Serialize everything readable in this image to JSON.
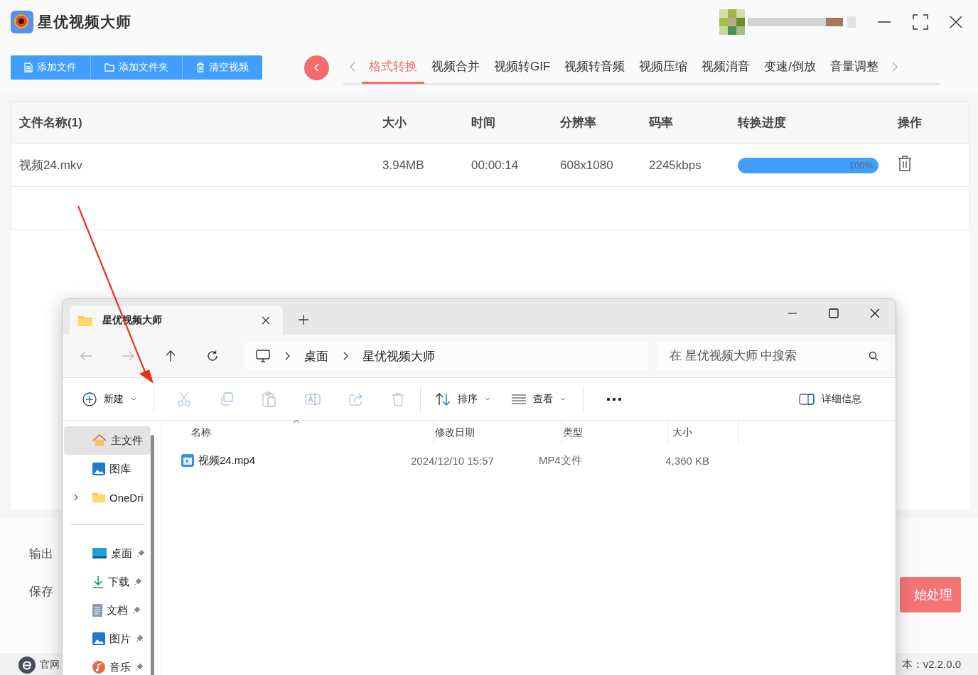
{
  "app": {
    "title": "星优视频大师"
  },
  "actions": [
    {
      "label": "添加文件",
      "kind": "file"
    },
    {
      "label": "添加文件夹",
      "kind": "folder"
    },
    {
      "label": "清空视频",
      "kind": "trash"
    }
  ],
  "tabs": [
    {
      "label": "格式转换",
      "selected": true
    },
    {
      "label": "视频合并",
      "selected": false
    },
    {
      "label": "视频转GIF",
      "selected": false
    },
    {
      "label": "视频转音频",
      "selected": false
    },
    {
      "label": "视频压缩",
      "selected": false
    },
    {
      "label": "视频消音",
      "selected": false
    },
    {
      "label": "变速/倒放",
      "selected": false
    },
    {
      "label": "音量调整",
      "selected": false
    }
  ],
  "table": {
    "columns": [
      "文件名称(1)",
      "大小",
      "时间",
      "分辨率",
      "码率",
      "转换进度",
      "操作"
    ],
    "rows": [
      {
        "name": "视频24.mkv",
        "size": "3.94MB",
        "duration": "00:00:14",
        "resolution": "608x1080",
        "bitrate": "2245kbps",
        "level": 1,
        "progress": "100%"
      }
    ]
  },
  "settings": [
    {
      "label": "输出"
    },
    {
      "label": "保存"
    }
  ],
  "start_button": "始处理",
  "footer": {
    "website": "官网",
    "version": "本：v2.2.0.0"
  },
  "explorer": {
    "tab": "星优视频大师",
    "path": [
      "桌面",
      "星优视频大师"
    ],
    "search": {
      "placeholder": "在 星优视频大师 中搜索"
    },
    "new": "新建",
    "sort": "排序",
    "view": "查看",
    "details": "详细信息",
    "nav": [
      {
        "label": "主文件",
        "kind": "home",
        "selected": true,
        "pinned": false,
        "expandable": false
      },
      {
        "label": "图库",
        "kind": "gallery",
        "selected": false,
        "pinned": false,
        "expandable": false
      },
      {
        "label": "OneDri",
        "kind": "folder",
        "selected": false,
        "pinned": false,
        "expandable": true
      },
      {
        "label": "桌面",
        "kind": "desktop",
        "selected": false,
        "pinned": true,
        "expandable": false
      },
      {
        "label": "下载",
        "kind": "download",
        "selected": false,
        "pinned": true,
        "expandable": false
      },
      {
        "label": "文档",
        "kind": "document",
        "selected": false,
        "pinned": true,
        "expandable": false
      },
      {
        "label": "图片",
        "kind": "gallery",
        "selected": false,
        "pinned": true,
        "expandable": false
      },
      {
        "label": "音乐",
        "kind": "music",
        "selected": false,
        "pinned": true,
        "expandable": false
      }
    ],
    "columns": [
      "名称",
      "修改日期",
      "类型",
      "大小"
    ],
    "files": [
      {
        "name": "视频24.mp4",
        "modified": "2024/12/10 15:57",
        "type": "MP4文件",
        "size": "4,360 KB"
      }
    ]
  }
}
